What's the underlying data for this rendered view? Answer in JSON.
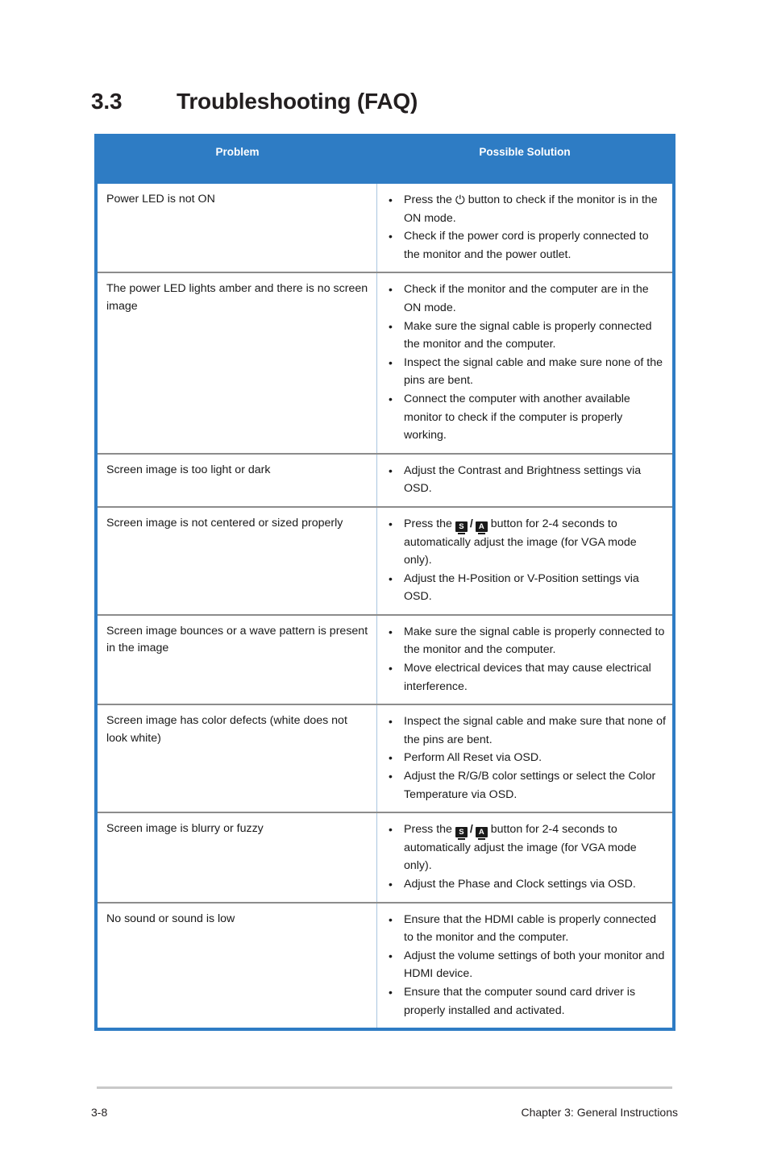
{
  "heading": {
    "number": "3.3",
    "title": "Troubleshooting (FAQ)"
  },
  "table": {
    "columns": {
      "problem": "Problem",
      "solution": "Possible Solution"
    },
    "header_bg": "#2e7cc4",
    "border_color": "#2e7cc4",
    "row_divider_color": "#8c8c8c",
    "column_divider_color": "#aac6e0",
    "rows": [
      {
        "problem": "Power  LED is not ON",
        "solutions": [
          {
            "parts": [
              {
                "type": "text",
                "value": "Press the "
              },
              {
                "type": "icon",
                "icon": "power-icon",
                "glyph": "⏻"
              },
              {
                "type": "text",
                "value": " button to check if the monitor is in the ON mode."
              }
            ]
          },
          {
            "parts": [
              {
                "type": "text",
                "value": "Check if the power cord is properly connected to the monitor and the power outlet."
              }
            ]
          }
        ]
      },
      {
        "problem": "The power LED lights amber and there is no screen image",
        "solutions": [
          {
            "parts": [
              {
                "type": "text",
                "value": "Check if the monitor and the computer are in the ON mode."
              }
            ]
          },
          {
            "parts": [
              {
                "type": "text",
                "value": "Make sure the signal cable is properly connected the monitor and the computer."
              }
            ]
          },
          {
            "parts": [
              {
                "type": "text",
                "value": "Inspect the signal cable and make sure none of the pins are bent."
              }
            ]
          },
          {
            "parts": [
              {
                "type": "text",
                "value": "Connect the computer with another available monitor to check if the computer is properly working."
              }
            ]
          }
        ]
      },
      {
        "problem": "Screen image is too light or dark",
        "solutions": [
          {
            "parts": [
              {
                "type": "text",
                "value": "Adjust the Contrast and Brightness settings via OSD."
              }
            ]
          }
        ]
      },
      {
        "problem": "Screen image is not centered or sized properly",
        "solutions": [
          {
            "parts": [
              {
                "type": "text",
                "value": "Press the "
              },
              {
                "type": "icon",
                "icon": "monitor-s-icon",
                "glyph": "S"
              },
              {
                "type": "sep",
                "value": "/"
              },
              {
                "type": "icon",
                "icon": "monitor-a-icon",
                "glyph": "A"
              },
              {
                "type": "text",
                "value": " button for 2-4 seconds to automatically adjust the image (for VGA mode only)."
              }
            ]
          },
          {
            "parts": [
              {
                "type": "text",
                "value": "Adjust the H-Position or V-Position settings via OSD."
              }
            ]
          }
        ]
      },
      {
        "problem": "Screen image bounces or a wave pattern is present in the image",
        "solutions": [
          {
            "parts": [
              {
                "type": "text",
                "value": "Make sure the signal cable is properly connected to the monitor and the computer."
              }
            ]
          },
          {
            "parts": [
              {
                "type": "text",
                "value": "Move electrical devices that may cause electrical interference."
              }
            ]
          }
        ]
      },
      {
        "problem": "Screen image has color defects (white does not look white)",
        "solutions": [
          {
            "parts": [
              {
                "type": "text",
                "value": "Inspect the signal cable and make sure that none of the pins are bent."
              }
            ]
          },
          {
            "parts": [
              {
                "type": "text",
                "value": "Perform All Reset via OSD."
              }
            ]
          },
          {
            "parts": [
              {
                "type": "text",
                "value": "Adjust the R/G/B color settings or select the Color Temperature via OSD."
              }
            ]
          }
        ]
      },
      {
        "problem": "Screen image is blurry or fuzzy",
        "solutions": [
          {
            "parts": [
              {
                "type": "text",
                "value": "Press the "
              },
              {
                "type": "icon",
                "icon": "monitor-s-icon",
                "glyph": "S"
              },
              {
                "type": "sep",
                "value": "/"
              },
              {
                "type": "icon",
                "icon": "monitor-a-icon",
                "glyph": "A"
              },
              {
                "type": "text",
                "value": " button for 2-4 seconds to automatically adjust the image (for VGA mode only)."
              }
            ]
          },
          {
            "parts": [
              {
                "type": "text",
                "value": "Adjust the Phase and Clock settings via OSD."
              }
            ]
          }
        ]
      },
      {
        "problem": "No sound or sound is low",
        "solutions": [
          {
            "parts": [
              {
                "type": "text",
                "value": "Ensure that the HDMI cable is properly connected to the monitor and the computer."
              }
            ]
          },
          {
            "parts": [
              {
                "type": "text",
                "value": "Adjust the volume settings of both your monitor and HDMI device."
              }
            ]
          },
          {
            "parts": [
              {
                "type": "text",
                "value": "Ensure that the computer sound card driver is properly installed and activated."
              }
            ]
          }
        ]
      }
    ],
    "bullet_glyph": "•"
  },
  "footer": {
    "page_number": "3-8",
    "chapter_label": "Chapter 3: General Instructions"
  }
}
